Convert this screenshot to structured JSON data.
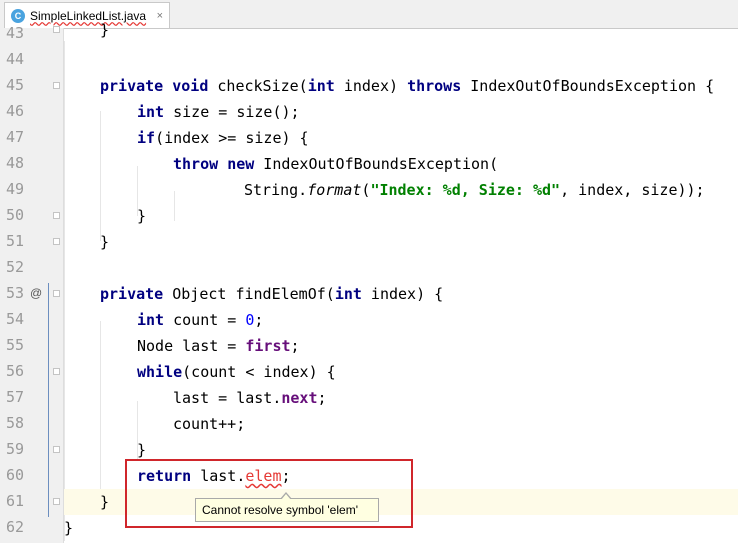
{
  "tab": {
    "icon": "C",
    "title": "SimpleLinkedList.java",
    "close": "×"
  },
  "gutter": {
    "annotation_icon": "@"
  },
  "lines": {
    "l43": {
      "n": "43",
      "t1": "}"
    },
    "l44": {
      "n": "44"
    },
    "l45": {
      "n": "45",
      "k1": "private",
      "k2": "void",
      "t1": " checkSize(",
      "k3": "int",
      "t2": " index) ",
      "k4": "throws",
      "t3": " IndexOutOfBoundsException {"
    },
    "l46": {
      "n": "46",
      "k1": "int",
      "t1": " size = size();"
    },
    "l47": {
      "n": "47",
      "k1": "if",
      "t1": "(index >= size) {"
    },
    "l48": {
      "n": "48",
      "k1": "throw",
      "k2": "new",
      "t1": " IndexOutOfBoundsException("
    },
    "l49": {
      "n": "49",
      "t1": "String.",
      "i1": "format",
      "t2": "(",
      "s1": "\"Index: %d, Size: %d\"",
      "t3": ", index, size));"
    },
    "l50": {
      "n": "50",
      "t1": "}"
    },
    "l51": {
      "n": "51",
      "t1": "}"
    },
    "l52": {
      "n": "52"
    },
    "l53": {
      "n": "53",
      "k1": "private",
      "t1": " Object findElemOf(",
      "k2": "int",
      "t2": " index) {"
    },
    "l54": {
      "n": "54",
      "k1": "int",
      "t1": " count = ",
      "n1": "0",
      "t2": ";"
    },
    "l55": {
      "n": "55",
      "t1": "Node last = ",
      "f1": "first",
      "t2": ";"
    },
    "l56": {
      "n": "56",
      "k1": "while",
      "t1": "(count < index) {"
    },
    "l57": {
      "n": "57",
      "t1": "last = last.",
      "f1": "next",
      "t2": ";"
    },
    "l58": {
      "n": "58",
      "t1": "count++;"
    },
    "l59": {
      "n": "59",
      "t1": "}"
    },
    "l60": {
      "n": "60",
      "k1": "return",
      "t1": " last.",
      "e1": "elem",
      "t2": ";"
    },
    "l61": {
      "n": "61",
      "t1": "}"
    },
    "l62": {
      "n": "62",
      "t1": "}"
    }
  },
  "tooltip": {
    "text": "Cannot resolve symbol 'elem'"
  }
}
